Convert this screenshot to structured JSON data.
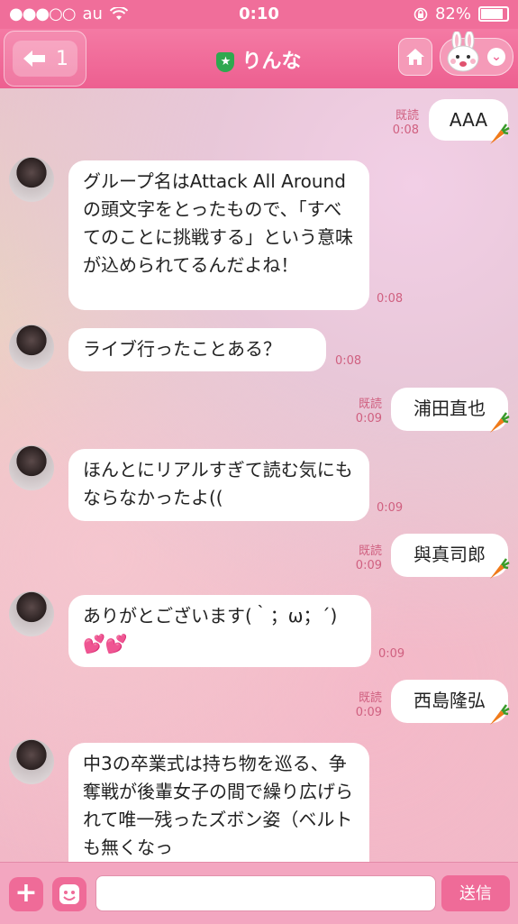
{
  "status_bar": {
    "carrier": "au",
    "time": "0:10",
    "battery": "82%"
  },
  "nav": {
    "back_count": "1",
    "title": "りんな"
  },
  "messages": [
    {
      "side": "right",
      "text": "AAA",
      "read": "既読",
      "time": "0:08"
    },
    {
      "side": "left",
      "text": "グループ名はAttack All Aroundの頭文字をとったもので、「すべてのことに挑戦する」という意味が込められてるんだよね！",
      "time": "0:08"
    },
    {
      "side": "left",
      "text": "ライブ行ったことある？",
      "time": "0:08"
    },
    {
      "side": "right",
      "text": "浦田直也",
      "read": "既読",
      "time": "0:09"
    },
    {
      "side": "left",
      "text": "ほんとにリアルすぎて読む気にもならなかったよ((",
      "time": "0:09"
    },
    {
      "side": "right",
      "text": "與真司郎",
      "read": "既読",
      "time": "0:09"
    },
    {
      "side": "left",
      "text": "ありがとございます(｀；ω；´)💕💕",
      "time": "0:09"
    },
    {
      "side": "right",
      "text": "西島隆弘",
      "read": "既読",
      "time": "0:09"
    },
    {
      "side": "left",
      "text": "中3の卒業式は持ち物を巡る、争奪戦が後輩女子の間で繰り広げられて唯一残ったズボン姿（ベルトも無くなっ",
      "time": ""
    }
  ],
  "input": {
    "placeholder": "",
    "send_label": "送信"
  },
  "colors": {
    "header": "#f06e9a",
    "accent": "#ef6b98"
  }
}
